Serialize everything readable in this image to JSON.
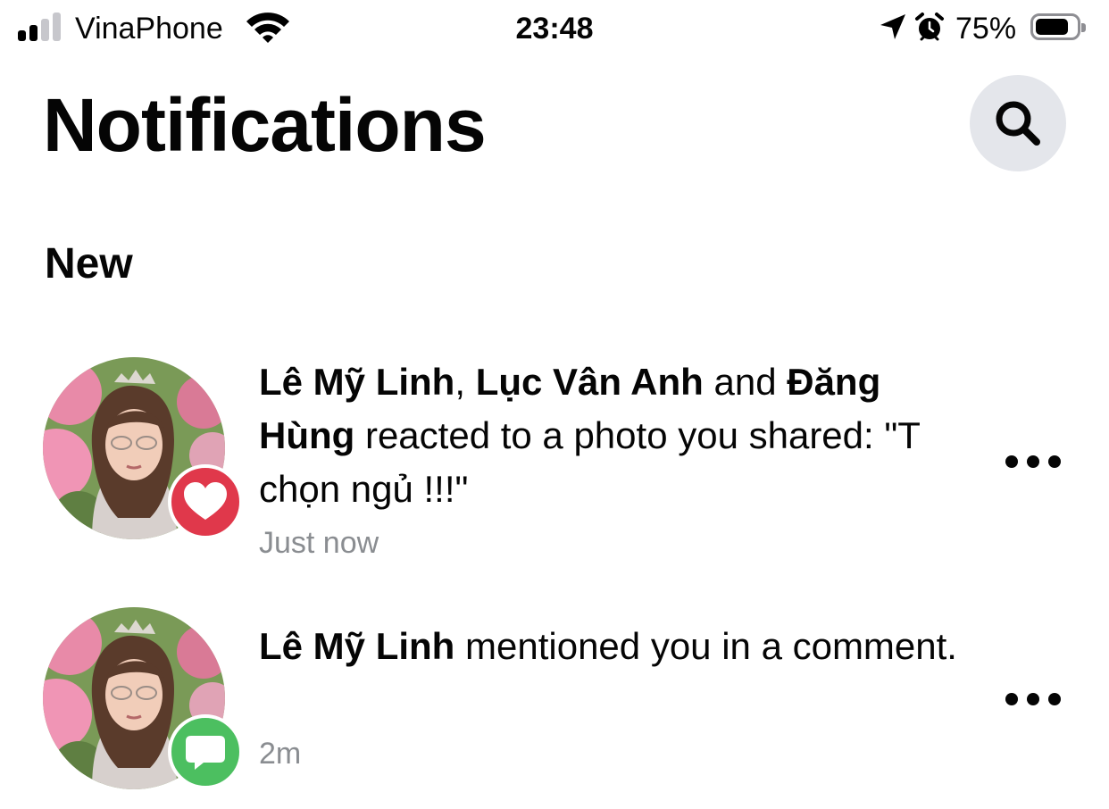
{
  "status_bar": {
    "carrier": "VinaPhone",
    "time": "23:48",
    "battery_percent": "75%",
    "battery_level": 0.75,
    "signal_bars_filled": 2,
    "signal_bars_total": 4,
    "icons": [
      "signal-icon",
      "wifi-icon",
      "location-arrow-icon",
      "alarm-icon",
      "battery-icon"
    ]
  },
  "header": {
    "title": "Notifications",
    "search_icon": "search-icon"
  },
  "section": {
    "title": "New"
  },
  "notifications": [
    {
      "names": [
        "Lê Mỹ Linh",
        "Lục Vân Anh",
        "Đăng Hùng"
      ],
      "sep1": ", ",
      "sep2": " and ",
      "text": " reacted to a photo you shared: \"T chọn ngủ !!!\"",
      "time": "Just now",
      "badge": {
        "icon": "heart-icon",
        "color": "#e0384b"
      },
      "more_icon": "more-dots-icon"
    },
    {
      "names": [
        "Lê Mỹ Linh"
      ],
      "text": " mentioned you in a comment.",
      "time": "2m",
      "badge": {
        "icon": "comment-icon",
        "color": "#4cbf60"
      },
      "more_icon": "more-dots-icon"
    }
  ],
  "colors": {
    "search_bg": "#e4e6eb",
    "secondary_text": "#8a8d91",
    "heart_badge": "#e0384b",
    "comment_badge": "#4cbf60"
  }
}
